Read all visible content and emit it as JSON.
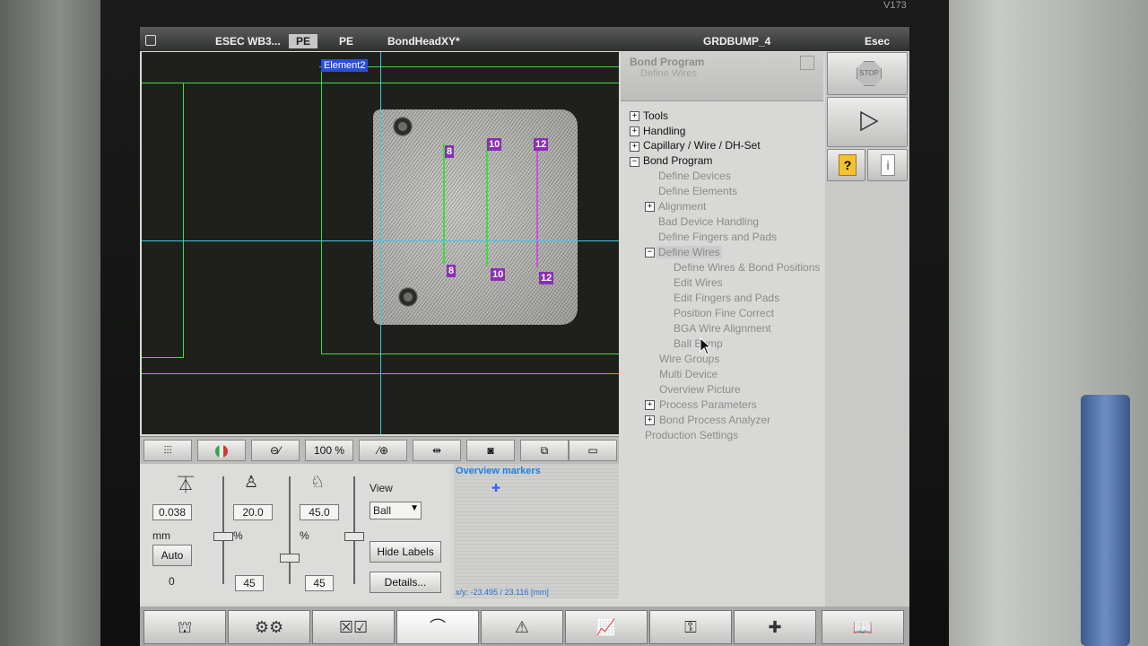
{
  "bezel_label": "V173",
  "titlebar": {
    "app": "ESEC WB3...",
    "mode_active": "PE",
    "mode": "PE",
    "axis": "BondHeadXY*",
    "program": "GRDBUMP_4",
    "brand": "Esec"
  },
  "vision": {
    "element_label": "Element2",
    "wire_marks": [
      "8",
      "10",
      "12"
    ]
  },
  "tree": {
    "header_title": "Bond Program",
    "header_subtitle": "Define Wires",
    "items": [
      {
        "label": "Tools",
        "expander": "+"
      },
      {
        "label": "Handling",
        "expander": "+"
      },
      {
        "label": "Capillary / Wire / DH-Set",
        "expander": "+"
      },
      {
        "label": "Bond Program",
        "expander": "−"
      },
      {
        "label": "Define Devices"
      },
      {
        "label": "Define Elements"
      },
      {
        "label": "Alignment",
        "expander": "+"
      },
      {
        "label": "Bad Device Handling"
      },
      {
        "label": "Define Fingers and Pads"
      },
      {
        "label": "Define Wires",
        "expander": "−"
      },
      {
        "label": "Define Wires & Bond Positions"
      },
      {
        "label": "Edit Wires"
      },
      {
        "label": "Edit Fingers and Pads"
      },
      {
        "label": "Position Fine Correct"
      },
      {
        "label": "BGA Wire Alignment"
      },
      {
        "label": "Ball Bump"
      },
      {
        "label": "Wire Groups"
      },
      {
        "label": "Multi Device"
      },
      {
        "label": "Overview Picture"
      },
      {
        "label": "Process Parameters",
        "expander": "+"
      },
      {
        "label": "Bond Process Analyzer",
        "expander": "+"
      },
      {
        "label": "Production Settings"
      }
    ]
  },
  "right_buttons": {
    "stop": "STOP",
    "help_icon": "question-icon",
    "info_icon": "info-icon"
  },
  "toolbar": {
    "zoom": "100 %"
  },
  "controls": {
    "focus_value": "0.038",
    "focus_unit": "mm",
    "auto_label": "Auto",
    "focus_bottom": "0",
    "light1_value": "20.0",
    "light1_unit": "%",
    "light1_bottom": "45",
    "light2_value": "45.0",
    "light2_unit": "%",
    "light2_bottom": "45",
    "view_label": "View",
    "view_selected": "Ball",
    "hide_labels": "Hide Labels",
    "details": "Details..."
  },
  "overview": {
    "title": "Overview markers",
    "coords": "x/y: -23.495 /  23.116 [mm]"
  },
  "colors": {
    "accent_blue": "#2c4ed8",
    "wire_mark": "#8a2fb2",
    "guide_green": "#3fdc3f",
    "guide_cyan": "#3fc8e6"
  }
}
